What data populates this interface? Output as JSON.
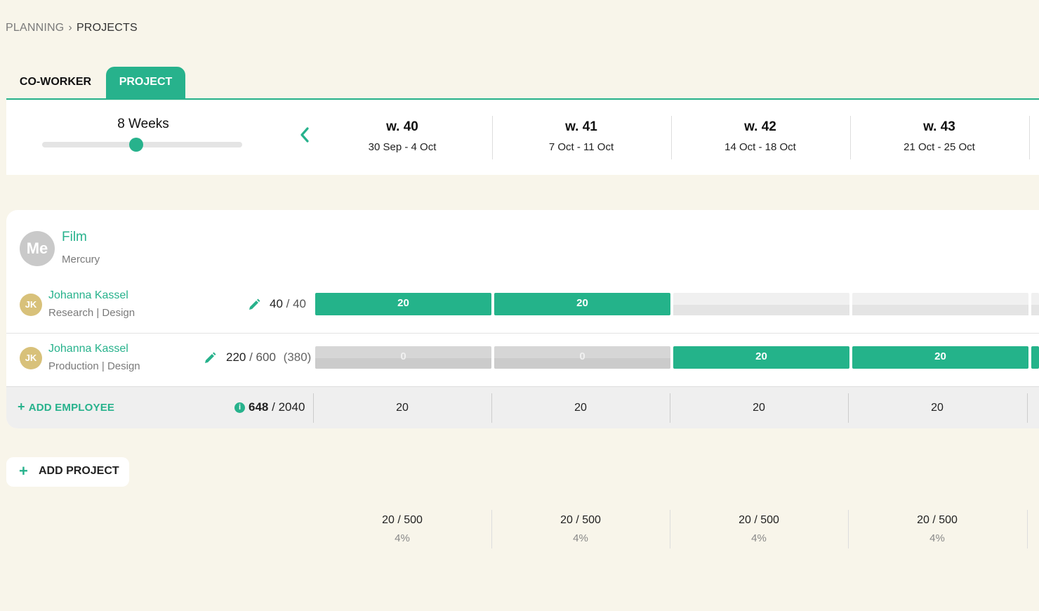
{
  "breadcrumb": {
    "parent": "PLANNING",
    "separator": "›",
    "current": "PROJECTS"
  },
  "tabs": [
    {
      "label": "CO-WORKER",
      "active": false
    },
    {
      "label": "PROJECT",
      "active": true
    }
  ],
  "timeline": {
    "range_label": "8 Weeks",
    "weeks": [
      {
        "title": "w. 40",
        "dates": "30 Sep - 4 Oct"
      },
      {
        "title": "w. 41",
        "dates": "7 Oct - 11 Oct"
      },
      {
        "title": "w. 42",
        "dates": "14 Oct - 18 Oct"
      },
      {
        "title": "w. 43",
        "dates": "21 Oct - 25 Oct"
      }
    ]
  },
  "project": {
    "avatar": "Me",
    "name": "Film",
    "client": "Mercury",
    "employees": [
      {
        "initials": "JK",
        "name": "Johanna Kassel",
        "role": "Research | Design",
        "hours_used": "40",
        "hours_total": "40",
        "hours_extra": "",
        "cells": [
          {
            "value": "20",
            "state": "filled"
          },
          {
            "value": "20",
            "state": "filled"
          },
          {
            "value": "",
            "state": "empty"
          },
          {
            "value": "",
            "state": "empty"
          }
        ]
      },
      {
        "initials": "JK",
        "name": "Johanna Kassel",
        "role": "Production | Design",
        "hours_used": "220",
        "hours_total": "600",
        "hours_extra": "(380)",
        "cells": [
          {
            "value": "0",
            "state": "zero"
          },
          {
            "value": "0",
            "state": "zero"
          },
          {
            "value": "20",
            "state": "filled"
          },
          {
            "value": "20",
            "state": "filled"
          }
        ]
      }
    ],
    "footer": {
      "add_employee_label": "ADD EMPLOYEE",
      "total_used": "648",
      "total_sep": "/",
      "total_capacity": "2040",
      "week_totals": [
        "20",
        "20",
        "20",
        "20"
      ]
    }
  },
  "add_project_label": "ADD PROJECT",
  "summary": [
    {
      "ratio": "20 / 500",
      "percent": "4%"
    },
    {
      "ratio": "20 / 500",
      "percent": "4%"
    },
    {
      "ratio": "20 / 500",
      "percent": "4%"
    },
    {
      "ratio": "20 / 500",
      "percent": "4%"
    }
  ],
  "colors": {
    "accent": "#27b28c",
    "background": "#f8f5ea",
    "avatar_project": "#c9c9c9",
    "avatar_employee": "#d8c17a"
  }
}
